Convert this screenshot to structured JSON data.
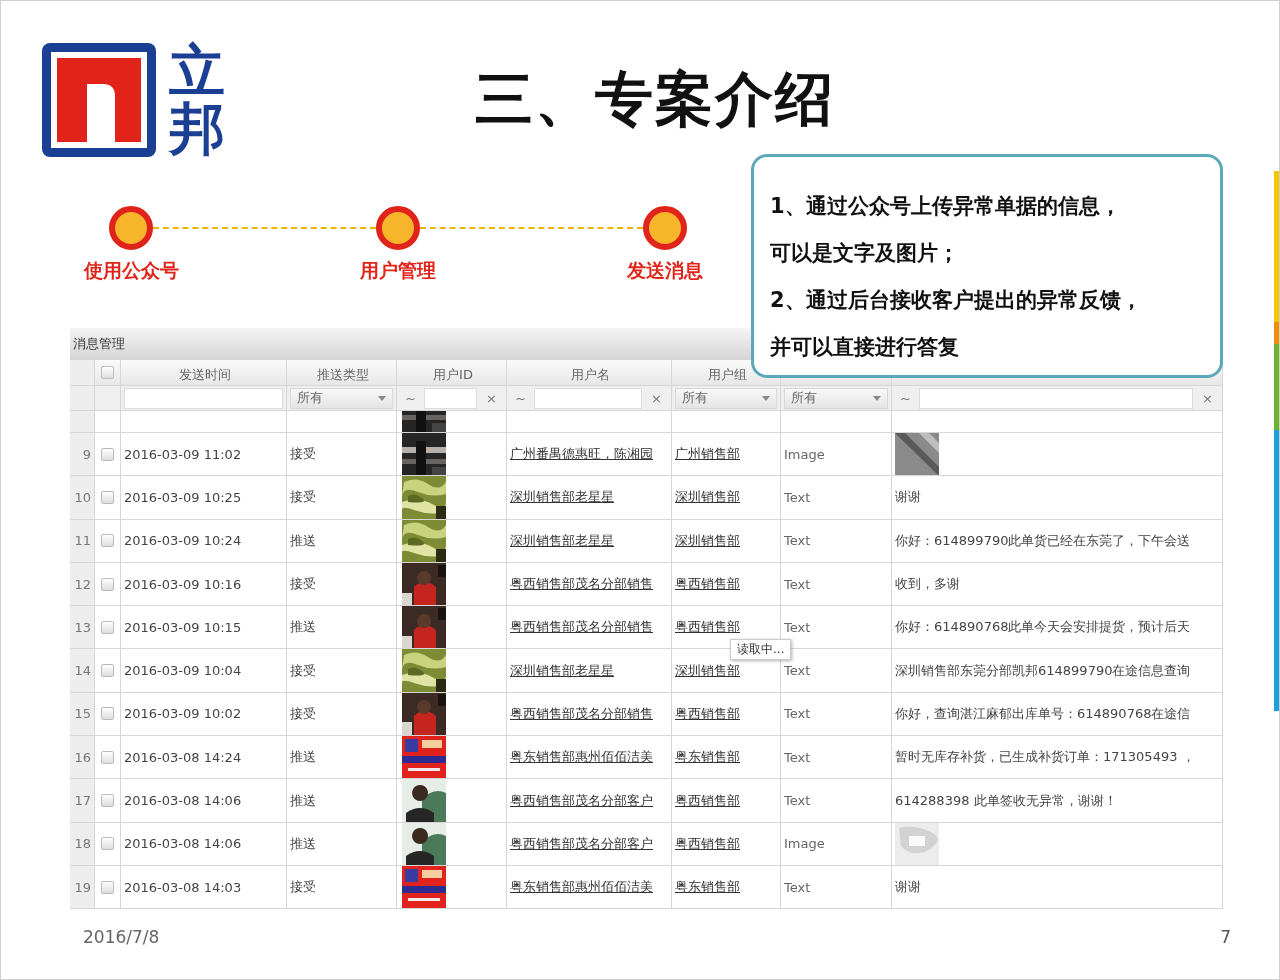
{
  "logo": {
    "text": "立邦"
  },
  "title": "三、专案介绍",
  "steps": [
    {
      "label": "使用公众号"
    },
    {
      "label": "用户管理"
    },
    {
      "label": "发送消息"
    }
  ],
  "callout": {
    "lines": [
      "1、通过公众号上传异常单据的信息，",
      "可以是文字及图片；",
      "2、通过后台接收客户提出的异常反馈，",
      "并可以直接进行答复"
    ]
  },
  "table": {
    "title": "消息管理",
    "header_checkbox": {
      "checked": false
    },
    "columns": [
      "发送时间",
      "推送类型",
      "用户ID",
      "用户名",
      "用户组"
    ],
    "filters": [
      {
        "kind": "text"
      },
      {
        "kind": "select",
        "value": "所有"
      },
      {
        "kind": "range",
        "op": "~",
        "clear": "×"
      },
      {
        "kind": "range",
        "op": "~",
        "clear": "×"
      },
      {
        "kind": "select",
        "value": "所有"
      },
      {
        "kind": "select",
        "value": "所有"
      },
      {
        "kind": "range",
        "op": "~",
        "clear": "×"
      }
    ],
    "rows": [
      {
        "number": "9",
        "checked": false,
        "time": "2016-03-09 11:02",
        "push_type": "接受",
        "user_name": "广州番禺德惠旺，陈湘园",
        "user_group": "广州销售部",
        "msg_type": "Image"
      },
      {
        "number": "10",
        "checked": false,
        "time": "2016-03-09 10:25",
        "push_type": "接受",
        "user_name": "深圳销售部老星星",
        "user_group": "深圳销售部",
        "msg_type": "Text",
        "message": {
          "kind": "text",
          "text": "谢谢"
        }
      },
      {
        "number": "11",
        "checked": false,
        "time": "2016-03-09 10:24",
        "push_type": "推送",
        "user_name": "深圳销售部老星星",
        "user_group": "深圳销售部",
        "msg_type": "Text",
        "message": {
          "kind": "text",
          "text": "你好：614899790此单货已经在东莞了，下午会送"
        }
      },
      {
        "number": "12",
        "checked": false,
        "time": "2016-03-09 10:16",
        "push_type": "接受",
        "user_name": "粤西销售部茂名分部销售",
        "user_group": "粤西销售部",
        "msg_type": "Text",
        "message": {
          "kind": "text",
          "text": "收到，多谢"
        }
      },
      {
        "number": "13",
        "checked": false,
        "time": "2016-03-09 10:15",
        "push_type": "推送",
        "user_name": "粤西销售部茂名分部销售",
        "user_group": "粤西销售部",
        "msg_type": "Text",
        "message": {
          "kind": "text",
          "text": "你好：614890768此单今天会安排提货，预计后天"
        }
      },
      {
        "number": "14",
        "checked": false,
        "time": "2016-03-09 10:04",
        "push_type": "接受",
        "user_name": "深圳销售部老星星",
        "user_group": "深圳销售部",
        "msg_type": "Text",
        "message": {
          "kind": "text",
          "text": "深圳销售部东莞分部凯邦614899790在途信息查询"
        }
      },
      {
        "number": "15",
        "checked": false,
        "time": "2016-03-09 10:02",
        "push_type": "接受",
        "user_name": "粤西销售部茂名分部销售",
        "user_group": "粤西销售部",
        "msg_type": "Text",
        "message": {
          "kind": "text",
          "text": "你好，查询湛江麻郁出库单号：614890768在途信"
        }
      },
      {
        "number": "16",
        "checked": false,
        "time": "2016-03-08 14:24",
        "push_type": "推送",
        "user_name": "粤东销售部惠州佰佰洁美",
        "user_group": "粤东销售部",
        "msg_type": "Text",
        "message": {
          "kind": "text",
          "text": "暂时无库存补货，已生成补货订单：171305493 ，"
        }
      },
      {
        "number": "17",
        "checked": false,
        "time": "2016-03-08 14:06",
        "push_type": "推送",
        "user_name": "粤西销售部茂名分部客户",
        "user_group": "粤西销售部",
        "msg_type": "Text",
        "message": {
          "kind": "text",
          "text": "614288398 此单签收无异常，谢谢！"
        }
      },
      {
        "number": "18",
        "checked": false,
        "time": "2016-03-08 14:06",
        "push_type": "推送",
        "user_name": "粤西销售部茂名分部客户",
        "user_group": "粤西销售部",
        "msg_type": "Image"
      },
      {
        "number": "19",
        "checked": false,
        "time": "2016-03-08 14:03",
        "push_type": "接受",
        "user_name": "粤东销售部惠州佰佰洁美",
        "user_group": "粤东销售部",
        "msg_type": "Text",
        "message": {
          "kind": "text",
          "text": "谢谢"
        }
      }
    ],
    "loading_tip": "读取中..."
  },
  "footer": {
    "date": "2016/7/8",
    "page": "7"
  }
}
